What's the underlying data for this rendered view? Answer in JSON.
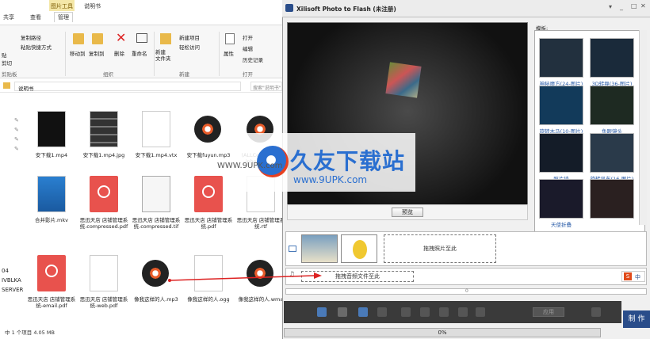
{
  "explorer": {
    "ribbon_tabs_top": [
      "图片工具",
      "说明书"
    ],
    "ribbon_tabs": [
      "共享",
      "查看",
      "管理"
    ],
    "ribbon": {
      "copy_path": "复制路径",
      "paste_shortcut": "粘贴快捷方式",
      "cut_partial": "贴",
      "cut": "剪切",
      "clipboard_partial": "剪贴板",
      "move_to": "移动到",
      "copy_to": "复制到",
      "delete": "删除",
      "rename": "重命名",
      "new_folder": "新建\n文件夹",
      "new_item": "新建项目",
      "easy_access": "轻松访问",
      "properties": "属性",
      "open": "打开",
      "edit": "编辑",
      "history": "历史记录",
      "group_organize": "组织",
      "group_new": "新建",
      "group_open": "打开"
    },
    "address": "说明书",
    "search_placeholder": "搜索\"说明书\"",
    "nav_partial": [
      "04",
      "IVBLKA",
      "SERVER"
    ],
    "files": [
      {
        "name": "安下载1.mp4",
        "kind": "video-dark"
      },
      {
        "name": "安下载1.mp4.jpg",
        "kind": "filmstrip"
      },
      {
        "name": "安下载1.mp4.vtx",
        "kind": "doc"
      },
      {
        "name": "安下载fuyun.mp3",
        "kind": "disc"
      },
      {
        "name": "(ALLConverter)\niphone.mp4",
        "kind": "disc"
      },
      {
        "name": "合并影片.mkv",
        "kind": "video-blue"
      },
      {
        "name": "思迅天店 店铺管理系统.compressed.pdf",
        "kind": "pdf"
      },
      {
        "name": "思迅天店 店铺管理系统.compressed.tif",
        "kind": "scan"
      },
      {
        "name": "思迅天店 店铺管理系统.pdf",
        "kind": "pdf"
      },
      {
        "name": "思迅天店 店铺管理系统.rtf",
        "kind": "doc"
      },
      {
        "name": "思迅天店 店铺管理系统-email.pdf",
        "kind": "pdf"
      },
      {
        "name": "思迅天店 店铺管理系统-web.pdf",
        "kind": "doc"
      },
      {
        "name": "像我这样的人.mp3",
        "kind": "disc"
      },
      {
        "name": "像我这样的人.ogg",
        "kind": "doc"
      },
      {
        "name": "像我这样的人.wma",
        "kind": "disc"
      }
    ],
    "status": "中 1 个项目  4.05 MB"
  },
  "xilisoft": {
    "title": "Xilisoft Photo to Flash (未注册)",
    "preview_button": "预览",
    "template_label": "模板:",
    "templates": [
      {
        "name": "神秘魔方(24-图片)"
      },
      {
        "name": "3D转换(36-图片)"
      },
      {
        "name": "旋转木马(10-图片)"
      },
      {
        "name": "鱼眼镜头"
      },
      {
        "name": "照片墙"
      },
      {
        "name": "旋转风车(16-图片)"
      },
      {
        "name": "天使折叠"
      },
      {
        "name": ""
      }
    ],
    "drop_photos": "拖拽照片至此",
    "drop_audio": "拖拽音频文件至此",
    "audio_counter": "0",
    "apply_button": "应用",
    "progress": "0%",
    "make_button": "制 作",
    "ime_badge": "中"
  },
  "watermark": {
    "text": "久友下载站",
    "url": "www.9UPK.com",
    "url_left": "WWW.9UPK.com"
  },
  "colors": {
    "accent": "#2a4d8a",
    "pdf": "#e8524d",
    "ribbon_highlight": "#f4e7a8"
  }
}
